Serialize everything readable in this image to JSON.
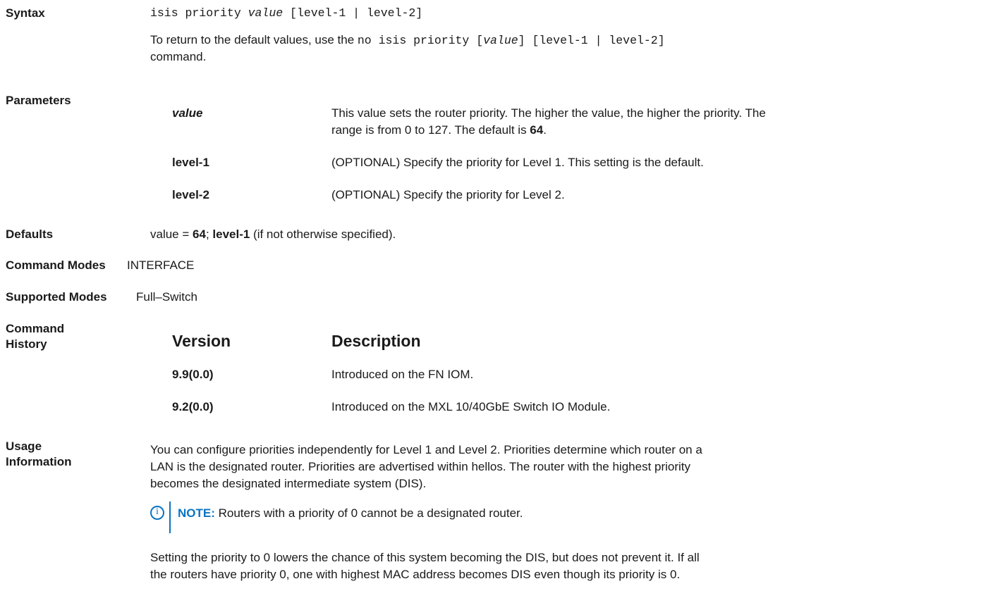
{
  "syntax": {
    "label": "Syntax",
    "cmd": "isis priority ",
    "arg": "value",
    "opts": " [level-1 | level-2]",
    "return_pre": "To return to the default values, use the ",
    "return_cmd": "no isis priority [",
    "return_arg": "value",
    "return_cmd2": "] [level-1 | level-2]",
    "return_post": "command."
  },
  "parameters": {
    "label": "Parameters",
    "rows": [
      {
        "name": "value",
        "desc1": "This value sets the router priority. The higher the value, the higher the priority. The",
        "desc2_pre": "range is from 0 to 127. The default is ",
        "desc2_bold": "64",
        "desc2_post": "."
      },
      {
        "name": "level-1",
        "desc": "(OPTIONAL) Specify the priority for Level 1. This setting is the default."
      },
      {
        "name": "level-2",
        "desc": "(OPTIONAL) Specify the priority for Level 2."
      }
    ]
  },
  "defaults": {
    "label": "Defaults",
    "t1": "value = ",
    "b1": "64",
    "t2": "; ",
    "b2": "level-1",
    "t3": " (if not otherwise specified)."
  },
  "command_modes": {
    "label": "Command Modes",
    "value": "INTERFACE"
  },
  "supported_modes": {
    "label": "Supported Modes",
    "value": "Full–Switch"
  },
  "history": {
    "label1": "Command",
    "label2": "History",
    "col_version": "Version",
    "col_description": "Description",
    "rows": [
      {
        "version": "9.9(0.0)",
        "description": "Introduced on the FN IOM."
      },
      {
        "version": "9.2(0.0)",
        "description": "Introduced on the MXL 10/40GbE Switch IO Module."
      }
    ]
  },
  "usage": {
    "label1": "Usage",
    "label2": "Information",
    "p1": [
      "You can configure priorities independently for Level 1 and Level 2. Priorities determine which router on a",
      "LAN is the designated router. Priorities are advertised within hellos. The router with the highest priority",
      "becomes the designated intermediate system (DIS)."
    ],
    "note_icon": "i",
    "note_label": "NOTE:",
    "note_text": " Routers with a priority of 0 cannot be a designated router.",
    "p2": [
      "Setting the priority to 0 lowers the chance of this system becoming the DIS, but does not prevent it. If all",
      "the routers have priority 0, one with highest MAC address becomes DIS even though its priority is 0."
    ]
  }
}
